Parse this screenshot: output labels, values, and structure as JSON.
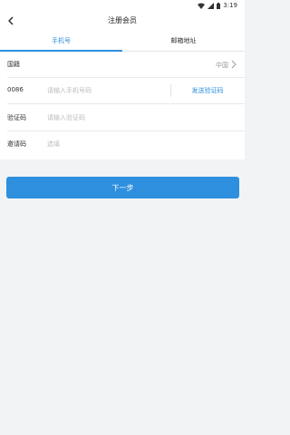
{
  "status_bar": {
    "time": "3:19"
  },
  "header": {
    "title": "注册会员"
  },
  "tabs": [
    {
      "label": "手机号",
      "active": true
    },
    {
      "label": "邮箱地址",
      "active": false
    }
  ],
  "form": {
    "country": {
      "label": "国籍",
      "value": "中国"
    },
    "phone": {
      "label": "0086",
      "placeholder": "请输入手机号码",
      "send_code_label": "发送验证码"
    },
    "code": {
      "label": "验证码",
      "placeholder": "请输入验证码"
    },
    "invite": {
      "label": "邀请码",
      "placeholder": "选填"
    }
  },
  "next_button": {
    "label": "下一步"
  },
  "colors": {
    "accent": "#2e8fde",
    "background": "#f2f3f5",
    "panel": "#ffffff"
  },
  "icons": {
    "back": "back-arrow-icon",
    "chevron": "chevron-right-icon",
    "wifi": "wifi-icon",
    "signal": "signal-icon",
    "battery": "battery-icon"
  }
}
